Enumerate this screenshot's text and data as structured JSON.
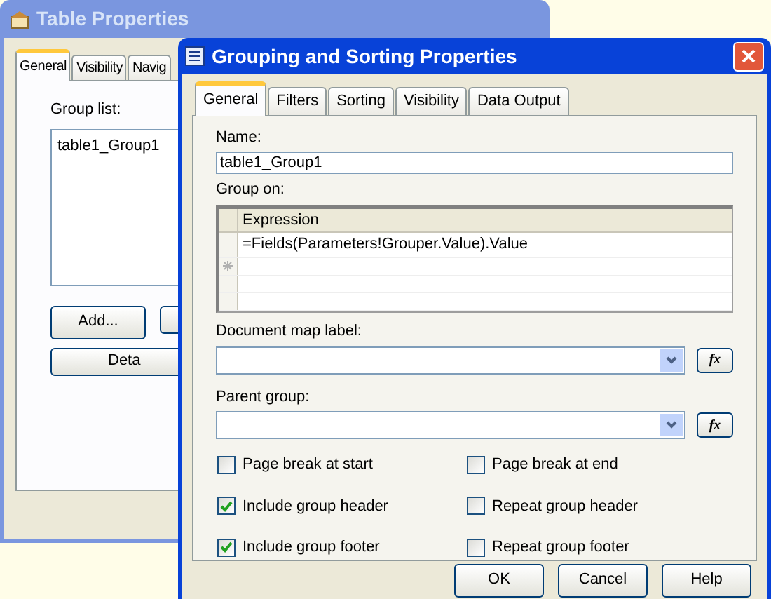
{
  "back_window": {
    "title": "Table Properties",
    "tabs": [
      {
        "label": "General",
        "selected": true
      },
      {
        "label": "Visibility",
        "selected": false
      },
      {
        "label": "Navig",
        "selected": false
      }
    ],
    "group_list_label": "Group list:",
    "group_list": [
      {
        "label": "table1_Group1",
        "selected": false
      }
    ],
    "buttons": [
      "Add..."
    ],
    "details_button": "Deta"
  },
  "dialog": {
    "title": "Grouping and Sorting Properties",
    "tabs": [
      {
        "label": "General",
        "selected": true
      },
      {
        "label": "Filters",
        "selected": false
      },
      {
        "label": "Sorting",
        "selected": false
      },
      {
        "label": "Visibility",
        "selected": false
      },
      {
        "label": "Data Output",
        "selected": false
      }
    ],
    "name_label": "Name:",
    "name_value": "table1_Group1",
    "group_on_label": "Group on:",
    "grid": {
      "columns": [
        "Expression"
      ],
      "rows": [
        {
          "expression": "=Fields(Parameters!Grouper.Value).Value",
          "new_row": false
        },
        {
          "expression": "",
          "new_row": true
        },
        {
          "expression": "",
          "new_row": false
        },
        {
          "expression": "",
          "new_row": false
        }
      ]
    },
    "document_map_label": "Document map label:",
    "parent_group_label": "Parent group:",
    "document_map_fx": "fx",
    "parent_group_fx": "fx",
    "checkboxes": [
      {
        "label": "Page break at start",
        "checked": false
      },
      {
        "label": "Page break at end",
        "checked": false
      },
      {
        "label": "Include group header",
        "checked": true
      },
      {
        "label": "Repeat group header",
        "checked": false
      },
      {
        "label": "Include group footer",
        "checked": true
      },
      {
        "label": "Repeat group footer",
        "checked": false
      }
    ],
    "buttons": [
      "OK",
      "Cancel",
      "Help"
    ]
  }
}
